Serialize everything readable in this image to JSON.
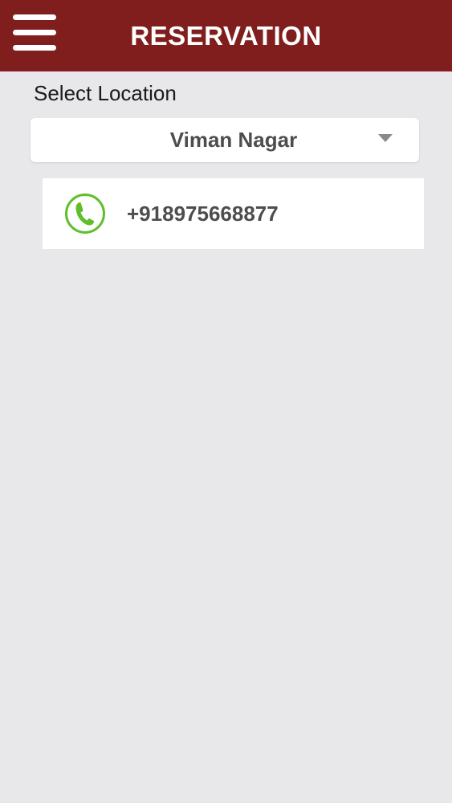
{
  "header": {
    "title": "RESERVATION",
    "menu_icon": "hamburger-menu-icon",
    "background_color": "#801e1e"
  },
  "location": {
    "label": "Select Location",
    "selected": "Viman Nagar",
    "arrow_icon": "dropdown-arrow-icon"
  },
  "contact": {
    "phone": "+918975668877",
    "phone_icon": "phone-icon",
    "icon_color": "#5fbf2a"
  }
}
